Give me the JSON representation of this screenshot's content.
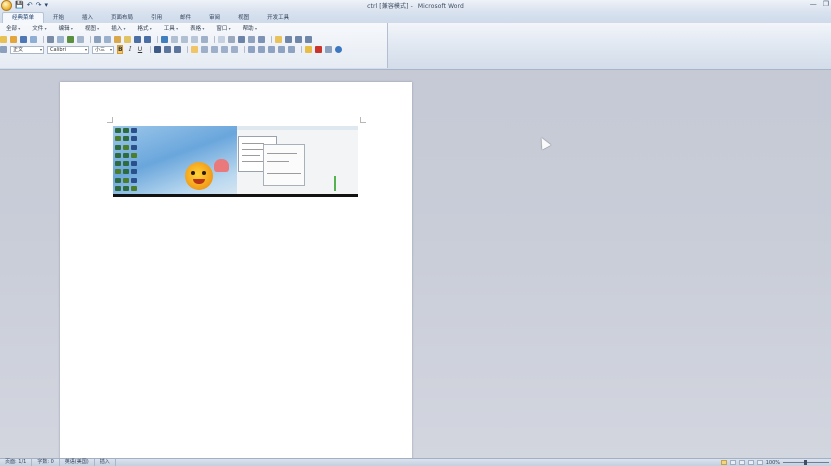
{
  "window": {
    "title_doc": "ctrl [兼容模式]",
    "title_sep": " - ",
    "title_app": "Microsoft Word",
    "controls": [
      "—",
      "❐"
    ]
  },
  "qat": [
    "💾",
    "↶",
    "↷",
    "▾"
  ],
  "tabs": [
    "经典菜单",
    "开始",
    "插入",
    "页面布局",
    "引用",
    "邮件",
    "审阅",
    "视图",
    "开发工具"
  ],
  "active_tab_index": 0,
  "menus": [
    "全部",
    "文件",
    "编辑",
    "视图",
    "插入",
    "格式",
    "工具",
    "表格",
    "窗口",
    "帮助"
  ],
  "format_bar": {
    "style_value": "正文",
    "font_value": "Calibri",
    "size_value": "小三",
    "bold": "B",
    "italic": "I",
    "underline": "U"
  },
  "status": {
    "page": "页面: 1/1",
    "words": "字数: 0",
    "language": "英语(美国)",
    "mode": "插入",
    "zoom": "100%"
  },
  "colors": {
    "accent_bold": "#f7c86a",
    "ribbon": "#dde5f0",
    "workspace": "#c9cdd8"
  }
}
